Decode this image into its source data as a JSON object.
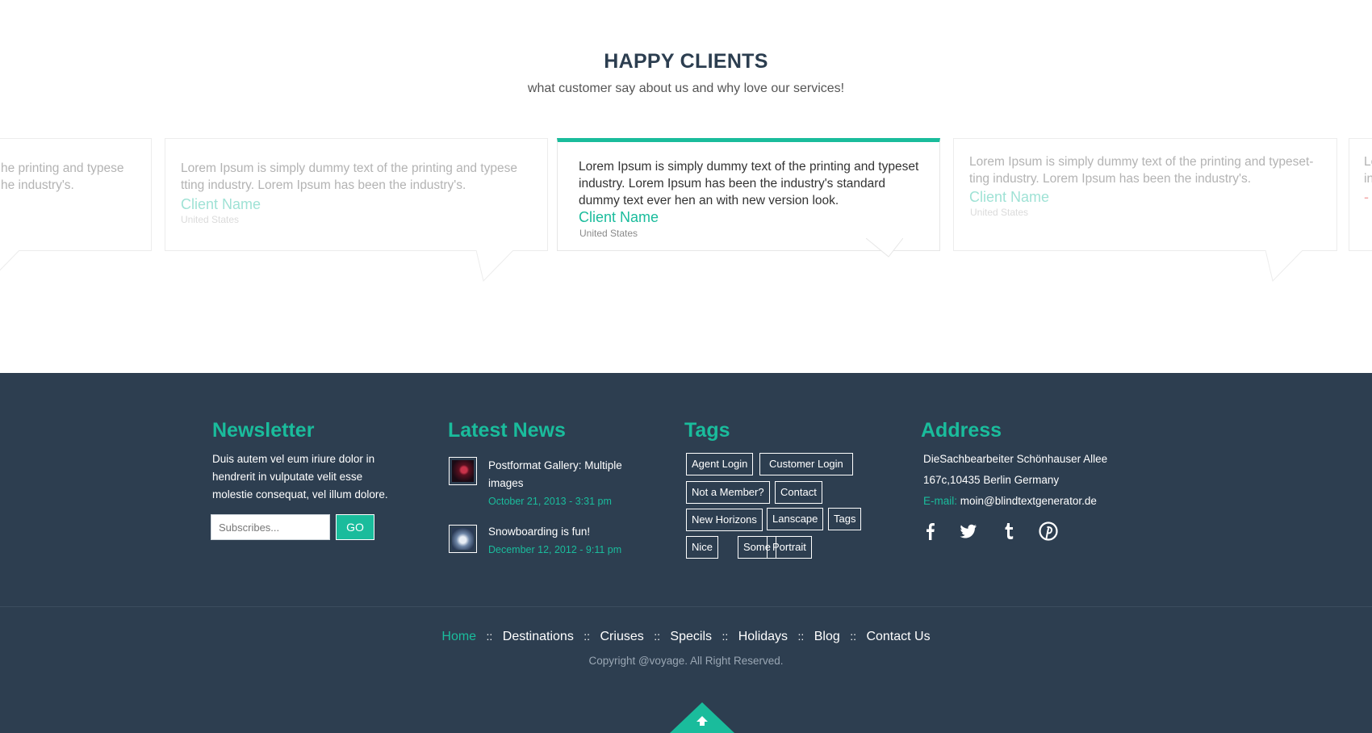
{
  "testimonials": {
    "title": "HAPPY CLIENTS",
    "subtitle": "what customer say about us and why love our services!",
    "cards": [
      {
        "text": "he printing and typese\nhe industry's.",
        "name": "",
        "country": ""
      },
      {
        "text": "Lorem Ipsum is simply dummy text of the printing and typese tting industry. Lorem Ipsum has been the industry's.",
        "name": "Client Name",
        "country": "United States"
      },
      {
        "text": "Lorem Ipsum is simply dummy text of the printing and typeset industry. Lorem Ipsum has been the industry's standard dummy text ever hen an with new version look.",
        "name": "Client Name",
        "country": "United States"
      },
      {
        "text": "Lorem Ipsum is simply dummy text of the printing and typeset-ting industry. Lorem Ipsum has been the industry's.",
        "name": "Client Name",
        "country": "United States"
      },
      {
        "text": "Lo\nin",
        "name": "-",
        "country": ""
      }
    ]
  },
  "newsletter": {
    "title": "Newsletter",
    "text": "Duis autem vel eum iriure dolor in hendrerit in vulputate velit esse molestie consequat, vel illum dolore.",
    "placeholder": "Subscribes...",
    "button": "GO"
  },
  "latest_news": {
    "title": "Latest News",
    "items": [
      {
        "title": "Postformat Gallery: Multiple images",
        "date": "October 21, 2013 - 3:31 pm"
      },
      {
        "title": "Snowboarding is fun!",
        "date": "December 12, 2012 - 9:11 pm"
      }
    ]
  },
  "tags": {
    "title": "Tags",
    "items": [
      "Agent Login",
      "Customer Login",
      "Not a Member?",
      "Contact",
      "New Horizons",
      "Lanscape",
      "Tags",
      "Nice",
      "Some",
      "Portrait"
    ]
  },
  "address": {
    "title": "Address",
    "line1": "DieSachbearbeiter Schönhauser Allee",
    "line2": "167c,10435 Berlin Germany",
    "email_label": "E-mail:",
    "email": "moin@blindtextgenerator.de",
    "social": [
      "facebook-icon",
      "twitter-icon",
      "tumblr-icon",
      "pinterest-icon"
    ]
  },
  "footer_nav": {
    "links": [
      "Home",
      "Destinations",
      "Criuses",
      "Specils",
      "Holidays",
      "Blog",
      "Contact Us"
    ],
    "separator": "::",
    "copyright": "Copyright @voyage. All Right Reserved."
  },
  "colors": {
    "accent": "#1abc9c",
    "footer_bg": "#2d3e50",
    "heading": "#2c3e50"
  }
}
